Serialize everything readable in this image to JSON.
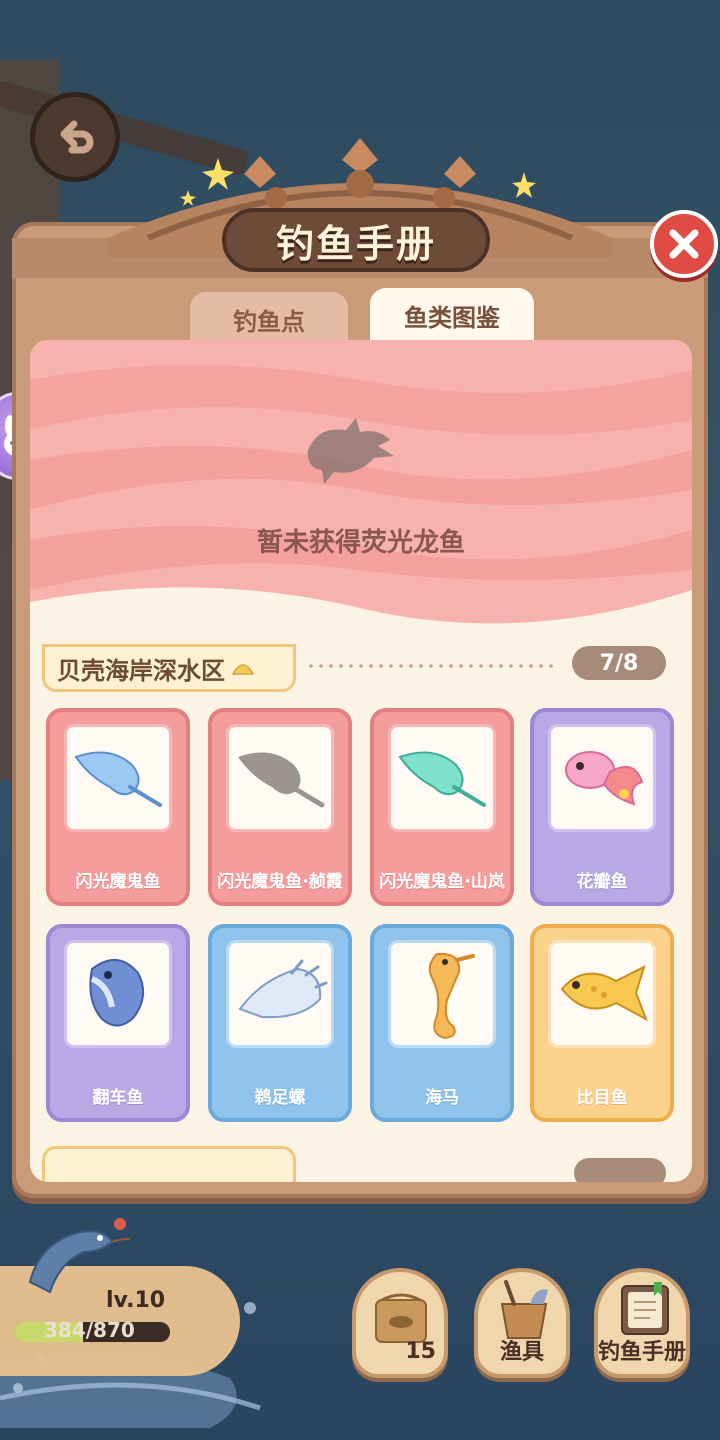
{
  "window": {
    "title": "钓鱼手册"
  },
  "tabs": [
    {
      "label": "钓鱼点",
      "active": false
    },
    {
      "label": "鱼类图鉴",
      "active": true
    }
  ],
  "hero": {
    "message": "暂未获得荧光龙鱼"
  },
  "region": {
    "name": "贝壳海岸深水区",
    "progress": "7/8"
  },
  "fish": [
    {
      "name": "闪光魔鬼鱼",
      "rarity": "pink",
      "icon": "manta-ray-blue"
    },
    {
      "name": "闪光魔鬼鱼·赪霞",
      "rarity": "pink",
      "icon": "manta-ray-silhouette"
    },
    {
      "name": "闪光魔鬼鱼·山岚",
      "rarity": "pink",
      "icon": "manta-ray-green"
    },
    {
      "name": "花瓣鱼",
      "rarity": "purple",
      "icon": "goldfish-pink"
    },
    {
      "name": "翻车鱼",
      "rarity": "purple",
      "icon": "sunfish"
    },
    {
      "name": "鹈足螺",
      "rarity": "blue",
      "icon": "conch-shell"
    },
    {
      "name": "海马",
      "rarity": "blue",
      "icon": "seahorse"
    },
    {
      "name": "比目鱼",
      "rarity": "orange",
      "icon": "flatfish"
    }
  ],
  "player": {
    "level": "lv.10",
    "xp": "384/870",
    "xp_fraction": 0.44
  },
  "hud": {
    "bait_count": "15",
    "gear_label": "渔具",
    "handbook_label": "钓鱼手册"
  },
  "colors": {
    "pink": "#f59c9c",
    "purple": "#b7a8e6",
    "blue": "#8fc3ec",
    "orange": "#fbd28c",
    "close": "#e04c44",
    "panel": "#c99b78"
  }
}
